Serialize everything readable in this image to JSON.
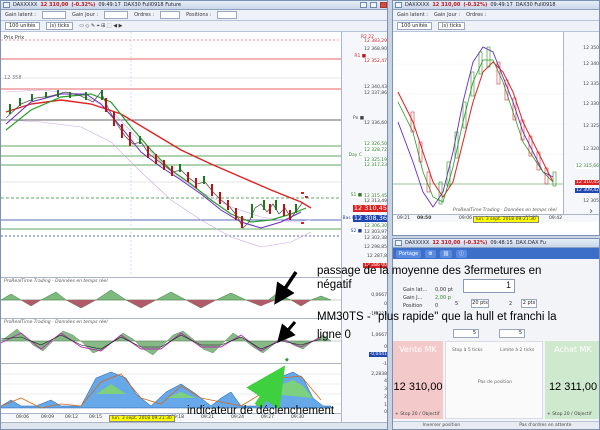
{
  "main_window": {
    "title": "DAXXXXX",
    "price": "12 310,00",
    "change": "(-0.32%)",
    "time": "09:49:17",
    "instrument": "DAX30 Full0918 Future",
    "toolbar": {
      "gain_latent": "Gain latent :",
      "gain_jour": "Gain Jour :",
      "ordres": "Ordres :",
      "positions": "Positions :",
      "units": "100 unités",
      "ticks": "(s) ticks",
      "prix": "Prix Prix"
    },
    "price_tags": {
      "r2": "R2 22",
      "r2_val": "12 383,29",
      "r1_top": "12 368,90",
      "r1": "R1 ■",
      "r1_val": "12 352,47",
      "pp_a": "12 340,43",
      "pp_b": "12 337,86",
      "px": "Px ■",
      "px_val": "12 336,60",
      "p1": "12 326,50",
      "p2": "12 328,72",
      "day": "Day C",
      "day_val": "12 325,19",
      "p3": "12 317,23",
      "s1": "S1 ■",
      "s1_val": "12 315,45",
      "p4": "12 313,49",
      "current": "12 310,45",
      "bid": "12 308,36",
      "bid_label": "Bas (d. Prix",
      "p5": "12 306,30",
      "p6": "12 303,97",
      "s2": "S2 ■",
      "s2_val": "12 302,38",
      "p7": "12 298,85",
      "p8": "12 287,8",
      "low": "12 286,00"
    },
    "left_price": "12 358",
    "indicator1_label": "ProRealTime Trading - Données en temps réel",
    "indicator2_label": "ProRealTime Trading - Données en temps réel",
    "indicator_values": {
      "i1_a": "0,0667",
      "i1_b": "0",
      "i1_c": "-1,3223",
      "i2_a": "1,0667",
      "i2_b": "0",
      "i2_c": "-0,0441",
      "i2_d": "-1",
      "i3_a": "2,2838",
      "i3_b": "4",
      "i3_c": "3",
      "i3_d": "2",
      "i3_e": "1",
      "i3_f": "0"
    },
    "time_labels": [
      "09:06",
      "09:09",
      "09:12",
      "09:15",
      "09:18",
      "09:21",
      "09:24",
      "09:27",
      "09:30"
    ],
    "cursor_date": "lun. 3 sept. 2018 09:21:30"
  },
  "right_chart": {
    "title": "DAXXXXX",
    "price": "12 310,00",
    "change": "(-0.32%)",
    "time": "09:49:17",
    "instrument": "DAX30 Full0918",
    "units": "100 unités",
    "ticks": "(s) ticks",
    "price_axis": [
      "12 350",
      "12 340",
      "12 335",
      "12 330",
      "12 325",
      "12 320",
      "12 315,66",
      "12 310,45",
      "12 309,42",
      "12 305"
    ],
    "status": "ProRealTime Trading - Données en temps réel",
    "time_labels": [
      "09:21",
      "09:50",
      "09:06",
      "09:35",
      "09:42"
    ],
    "cursor_date": "lun. 3 sept. 2018 09:21:30"
  },
  "order_panel": {
    "title": "DAXXXXX",
    "price": "12 310,00",
    "change": "(-0.32%)",
    "time": "09:48:15",
    "instrument": "DAX.DAX Fu",
    "tab": "Portage",
    "gain_latent_label": "Gain lat...",
    "gain_latent_val": "0,00 pt",
    "gain_jour_label": "Gain J...",
    "gain_jour_val": "2,00 p",
    "position_label": "Position",
    "position_val": "0",
    "quantity": "1",
    "step_5": "5",
    "step_20": "20 pts",
    "step_2": "2",
    "step_2pts": "2 pts",
    "small_qty": "5",
    "small_qty2": "5",
    "sell_title": "Vente MK",
    "buy_title": "Achat MK",
    "sell_price": "12 310,00",
    "buy_price": "12 311,00",
    "stop_label": "Stop à 5 ticks",
    "limit_label": "Limite à 2 ticks",
    "no_position": "Pas de position",
    "sell_stop": "+ Stop 20 / Objectif",
    "buy_stop": "+ Stop 20 / Objectif",
    "bottom_left": "Inverser position",
    "bottom_right": "Pas d'ordres en attente"
  },
  "annotations": {
    "a1": "passage de la moyenne des 3fermetures en",
    "a1b": "négatif",
    "a2": "MM30TS - \"plus rapide\" que la hull et franchi la",
    "a2b": "ligne 0",
    "a3": "indicateur de déclenchement"
  }
}
